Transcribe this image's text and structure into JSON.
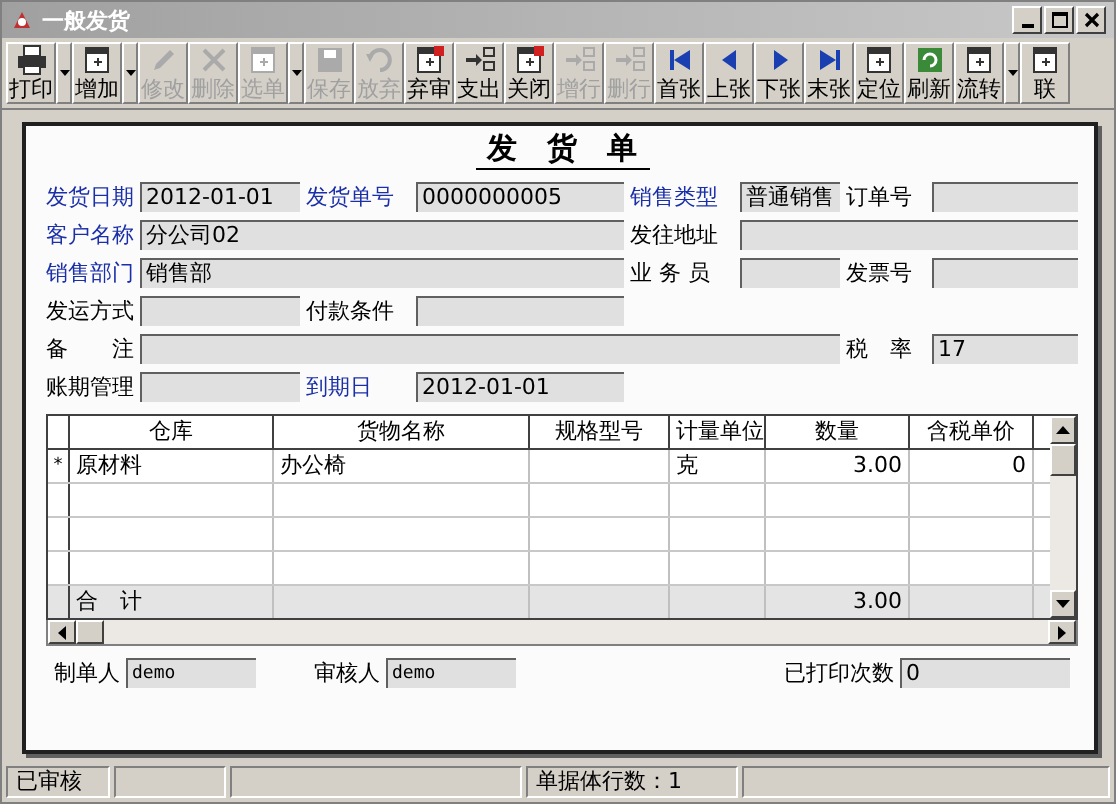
{
  "window": {
    "title": "一般发货"
  },
  "toolbar": [
    {
      "label": "打印",
      "disabled": false,
      "dropdown": true
    },
    {
      "label": "增加",
      "disabled": false,
      "dropdown": true
    },
    {
      "label": "修改",
      "disabled": true,
      "dropdown": false
    },
    {
      "label": "删除",
      "disabled": true,
      "dropdown": false
    },
    {
      "label": "选单",
      "disabled": true,
      "dropdown": true
    },
    {
      "label": "保存",
      "disabled": true,
      "dropdown": false
    },
    {
      "label": "放弃",
      "disabled": true,
      "dropdown": false
    },
    {
      "label": "弃审",
      "disabled": false,
      "dropdown": false
    },
    {
      "label": "支出",
      "disabled": false,
      "dropdown": false
    },
    {
      "label": "关闭",
      "disabled": false,
      "dropdown": false
    },
    {
      "label": "增行",
      "disabled": true,
      "dropdown": false
    },
    {
      "label": "删行",
      "disabled": true,
      "dropdown": false
    },
    {
      "label": "首张",
      "disabled": false,
      "dropdown": false
    },
    {
      "label": "上张",
      "disabled": false,
      "dropdown": false
    },
    {
      "label": "下张",
      "disabled": false,
      "dropdown": false
    },
    {
      "label": "末张",
      "disabled": false,
      "dropdown": false
    },
    {
      "label": "定位",
      "disabled": false,
      "dropdown": false
    },
    {
      "label": "刷新",
      "disabled": false,
      "dropdown": false
    },
    {
      "label": "流转",
      "disabled": false,
      "dropdown": true
    },
    {
      "label": "联",
      "disabled": false,
      "dropdown": false
    }
  ],
  "form": {
    "title": "发　货　单",
    "fields": [
      {
        "label": "发货日期",
        "value": "2012-01-01",
        "required": true
      },
      {
        "label": "发货单号",
        "value": "0000000005",
        "required": true
      },
      {
        "label": "销售类型",
        "value": "普通销售",
        "required": true
      },
      {
        "label": "订单号",
        "required": false
      },
      {
        "label": "客户名称",
        "value": "分公司02",
        "required": true
      },
      {
        "label": "发往地址",
        "required": false
      },
      {
        "label": "销售部门",
        "value": "销售部",
        "required": true
      },
      {
        "label": "业 务 员",
        "required": false
      },
      {
        "label": "发票号",
        "required": false
      },
      {
        "label": "发运方式",
        "required": false
      },
      {
        "label": "付款条件",
        "required": false
      },
      {
        "label": "备　　注",
        "required": false
      },
      {
        "label": "税　率",
        "value": "17",
        "required": false
      },
      {
        "label": "账期管理",
        "required": false
      },
      {
        "label": "到期日",
        "value": "2012-01-01",
        "required": true
      }
    ]
  },
  "table": {
    "columns": [
      {
        "label": "仓库",
        "kind": "text"
      },
      {
        "label": "货物名称",
        "kind": "text"
      },
      {
        "label": "规格型号",
        "kind": "text"
      },
      {
        "label": "计量单位",
        "kind": "text"
      },
      {
        "label": "数量",
        "kind": "number"
      },
      {
        "label": "含税单价",
        "kind": "number"
      }
    ],
    "rows": [
      {
        "marker": "*",
        "cells": [
          "原材料",
          "办公椅",
          "",
          "克",
          "3.00",
          "0"
        ]
      }
    ],
    "total": {
      "label": "合　计",
      "cells": [
        "",
        "",
        "",
        "",
        "3.00",
        ""
      ]
    }
  },
  "signatures": [
    {
      "label": "制单人",
      "value": "demo"
    },
    {
      "label": "审核人",
      "value": "demo"
    },
    {
      "label": "已打印次数",
      "value": "0"
    }
  ],
  "status_bar": [
    "已审核",
    "单据体行数：1"
  ]
}
